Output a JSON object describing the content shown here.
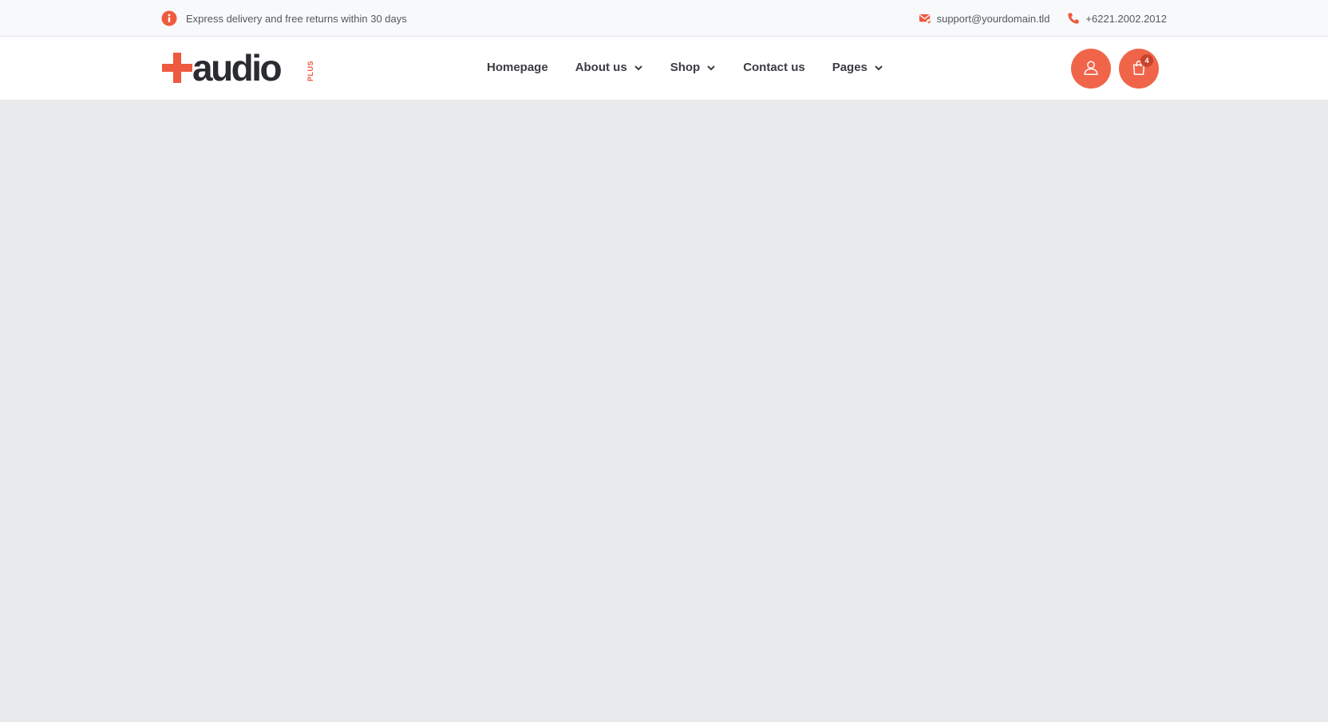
{
  "colors": {
    "accent": "#f0654a",
    "text_dark": "#3b3d42",
    "text_muted": "#55575c",
    "content_bg": "#e9eaec"
  },
  "topbar": {
    "promo_icon": "info-icon",
    "promo_text": "Express delivery and free returns within 30 days",
    "email_icon": "mail-check-icon",
    "email": "support@yourdomain.tld",
    "phone_icon": "phone-icon",
    "phone": "+6221.2002.2012"
  },
  "logo": {
    "word": "audio",
    "sub": "PLUS"
  },
  "nav": {
    "items": [
      {
        "label": "Homepage",
        "has_dropdown": false
      },
      {
        "label": "About us",
        "has_dropdown": true
      },
      {
        "label": "Shop",
        "has_dropdown": true
      },
      {
        "label": "Contact us",
        "has_dropdown": false
      },
      {
        "label": "Pages",
        "has_dropdown": true
      }
    ]
  },
  "header_actions": {
    "account_icon": "user-icon",
    "cart_icon": "shopping-bag-icon",
    "cart_count": "4"
  }
}
